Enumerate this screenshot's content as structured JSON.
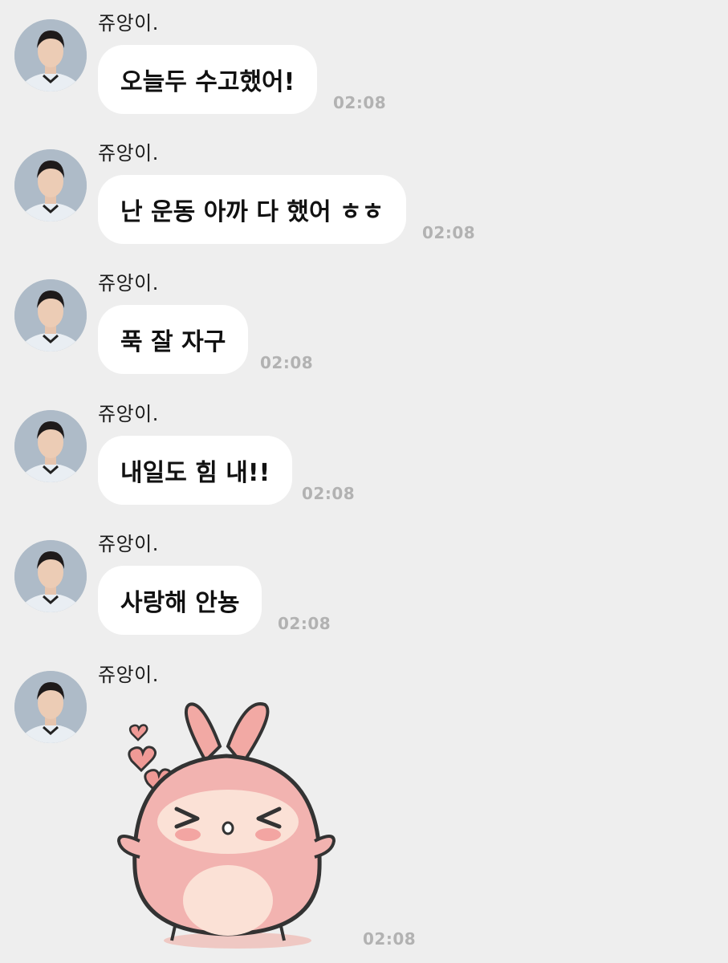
{
  "chat": {
    "messages": [
      {
        "sender": "쥬앙이.",
        "text": "오늘두 수고했어!",
        "time": "02:08"
      },
      {
        "sender": "쥬앙이.",
        "text": "난 운동 아까 다 했어 ㅎㅎ",
        "time": "02:08"
      },
      {
        "sender": "쥬앙이.",
        "text": "푹 잘 자구",
        "time": "02:08"
      },
      {
        "sender": "쥬앙이.",
        "text": "내일도 힘 내!!",
        "time": "02:08"
      },
      {
        "sender": "쥬앙이.",
        "text": "사랑해 안뇽",
        "time": "02:08"
      }
    ],
    "sticker_message": {
      "sender": "쥬앙이.",
      "time": "02:08",
      "sticker": "pink-bunny-sticker"
    }
  },
  "colors": {
    "background": "#eeeeee",
    "bubble": "#ffffff",
    "timestamp": "#b2b2b2",
    "sticker_body": "#f2b3b0",
    "sticker_outline": "#333333"
  }
}
